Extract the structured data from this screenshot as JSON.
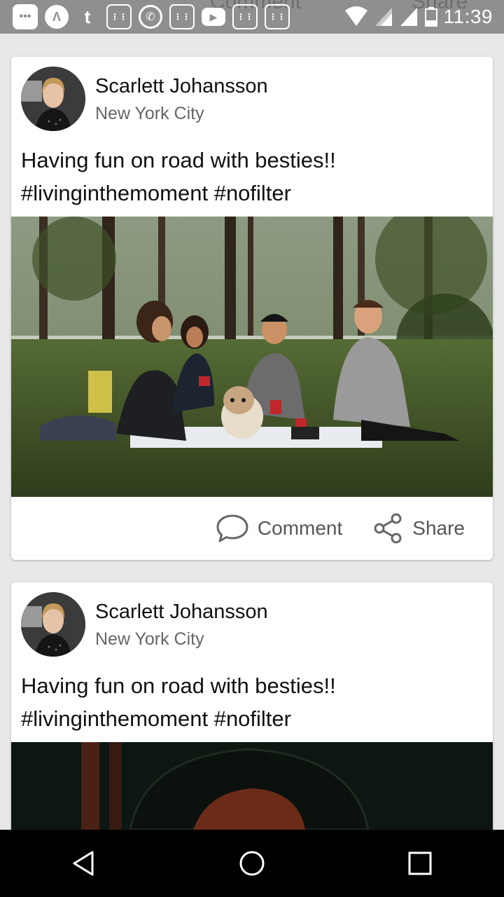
{
  "status_bar": {
    "time": "11:39",
    "ghost_comment_label": "Comment",
    "ghost_share_label": "Share",
    "notification_icons": [
      "chat-icon",
      "triangle-app-icon",
      "tumblr-icon",
      "calculator-icon",
      "whatsapp-icon",
      "calculator-icon",
      "youtube-icon",
      "calculator-icon",
      "calculator-icon"
    ],
    "system_icons": [
      "wifi-icon",
      "signal-icon",
      "signal-icon",
      "battery-icon"
    ]
  },
  "posts": [
    {
      "author": "Scarlett Johansson",
      "location": "New York City",
      "text": "Having fun on road with besties!!\n#livinginthemoment #nofilter",
      "comment_label": "Comment",
      "share_label": "Share"
    },
    {
      "author": "Scarlett Johansson",
      "location": "New York City",
      "text": "Having fun on road with besties!!\n#livinginthemoment #nofilter"
    }
  ],
  "nav": {
    "back_icon": "back-icon",
    "home_icon": "home-icon",
    "recents_icon": "recents-icon"
  },
  "colors": {
    "status_bar": "#8f8f8f",
    "background": "#e8e8e8",
    "card": "#ffffff",
    "nav_bar": "#000000",
    "action_text": "#555555"
  }
}
